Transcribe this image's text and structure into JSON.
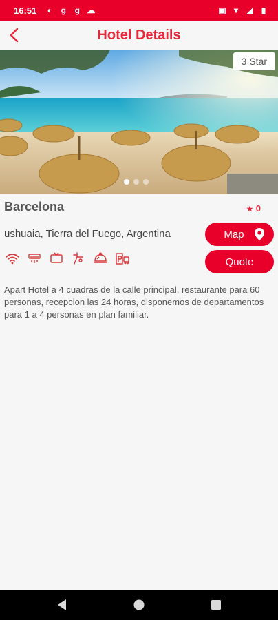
{
  "status_bar": {
    "time": "16:51"
  },
  "header": {
    "title": "Hotel Details"
  },
  "hero": {
    "star_badge": "3 Star",
    "slide_count": 3,
    "active_slide": 1
  },
  "hotel": {
    "name": "Barcelona",
    "rating": "0",
    "location": "ushuaia, Tierra del Fuego, Argentina",
    "description": "Apart Hotel a 4 cuadras de la calle principal, restaurante para 60 personas, recepcion las 24 horas, disponemos de departamentos para 1 a 4 personas en plan familiar."
  },
  "buttons": {
    "map_label": "Map",
    "quote_label": "Quote"
  },
  "amenities": [
    "wifi-icon",
    "air-conditioner-icon",
    "tv-icon",
    "hair-dryer-icon",
    "room-service-icon",
    "parking-icon"
  ],
  "colors": {
    "accent": "#e8002a",
    "title": "#e8283a"
  }
}
